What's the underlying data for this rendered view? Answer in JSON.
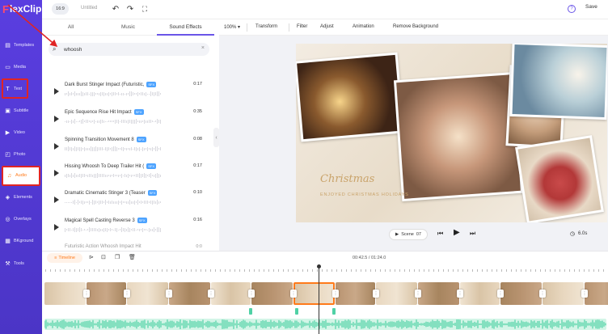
{
  "app": {
    "logo_text": "lexClip",
    "logo_mark": "F"
  },
  "topbar": {
    "aspect_ratio": "16:9",
    "project_title": "Untitled",
    "save_label": "Save",
    "help_label": "?"
  },
  "sidebar": {
    "items": [
      {
        "label": "Templates",
        "icon": "templates-icon"
      },
      {
        "label": "Media",
        "icon": "media-icon"
      },
      {
        "label": "Text",
        "icon": "text-icon"
      },
      {
        "label": "Subtitle",
        "icon": "subtitle-icon"
      },
      {
        "label": "Video",
        "icon": "video-icon"
      },
      {
        "label": "Photo",
        "icon": "photo-icon"
      },
      {
        "label": "Audio",
        "icon": "audio-icon",
        "active": true
      },
      {
        "label": "Elements",
        "icon": "elements-icon"
      },
      {
        "label": "Overlays",
        "icon": "overlays-icon"
      },
      {
        "label": "BKground",
        "icon": "background-icon"
      },
      {
        "label": "Tools",
        "icon": "tools-icon"
      }
    ]
  },
  "media_panel": {
    "tabs": [
      {
        "label": "All"
      },
      {
        "label": "Music"
      },
      {
        "label": "Sound Effects",
        "active": true
      }
    ],
    "search": {
      "value": "whoosh"
    },
    "sfx_badge": "SFX",
    "sounds": [
      {
        "name": "Dark Burst Stinger Impact (Futuristic,",
        "duration": "0:17"
      },
      {
        "name": "Epic Sequence Rise Hit Impact",
        "duration": "0:35"
      },
      {
        "name": "Spinning Transition Movement 8",
        "duration": "0:08"
      },
      {
        "name": "Hissing Whoosh To Deep Trailer Hit (",
        "duration": "0:17"
      },
      {
        "name": "Dramatic Cinematic Stinger 3 (Teaser",
        "duration": "0:10"
      },
      {
        "name": "Magical Spell Casting Reverse 3",
        "duration": "0:16"
      },
      {
        "name": "Futuristic Action Whoosh Impact Hit",
        "duration": "0:0"
      }
    ]
  },
  "toolbar": {
    "zoom": "100%",
    "items": [
      "Transform",
      "Filter",
      "Adjust",
      "Animation",
      "Remove Background"
    ]
  },
  "stage": {
    "title_script": "Christmas",
    "subtitle": "ENJOYED CHRISTMAS HOLIDAYS"
  },
  "player": {
    "scene_label": "Scene",
    "scene_number": "07",
    "duration": "6.0s"
  },
  "timeline": {
    "button_label": "Timeline",
    "current_time": "00:42.5",
    "total_time": "01:24.0"
  },
  "colors": {
    "sidebar": "#4b35c6",
    "accent": "#6a55e8",
    "orange": "#ff7a1a",
    "highlight_red": "#e02424",
    "audio_green": "#4fd1a5"
  }
}
